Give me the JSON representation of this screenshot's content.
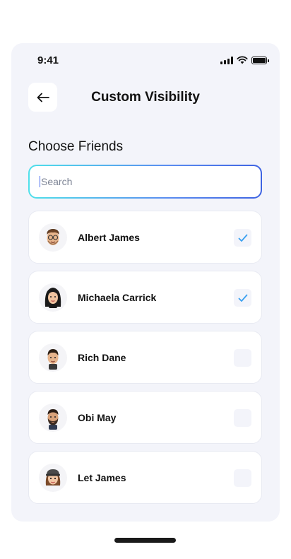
{
  "status_bar": {
    "time": "9:41",
    "signal_icon": "signal-icon",
    "wifi_icon": "wifi-icon",
    "battery_icon": "battery-icon"
  },
  "header": {
    "back_icon": "arrow-left-icon",
    "title": "Custom Visibility"
  },
  "section": {
    "title": "Choose Friends"
  },
  "search": {
    "placeholder": "Search",
    "value": ""
  },
  "friends": [
    {
      "name": "Albert James",
      "checked": true,
      "avatar": "avatar-glasses-man"
    },
    {
      "name": "Michaela Carrick",
      "checked": true,
      "avatar": "avatar-long-hair-woman"
    },
    {
      "name": "Rich Dane",
      "checked": false,
      "avatar": "avatar-short-hair-man"
    },
    {
      "name": "Obi May",
      "checked": false,
      "avatar": "avatar-bearded-man"
    },
    {
      "name": "Let James",
      "checked": false,
      "avatar": "avatar-cap-woman"
    }
  ],
  "colors": {
    "accent": "#3e63e2",
    "check": "#3aa0f0",
    "background": "#f3f4fa"
  }
}
